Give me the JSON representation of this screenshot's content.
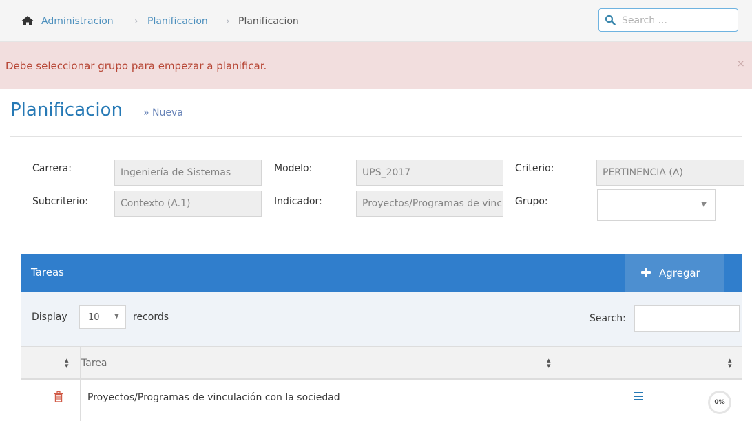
{
  "breadcrumbs": {
    "items": [
      "Administracion",
      "Planificacion",
      "Planificacion"
    ]
  },
  "search": {
    "placeholder": "Search ..."
  },
  "alert": {
    "message": "Debe seleccionar grupo para empezar a planificar.",
    "close_label": "×"
  },
  "page": {
    "title": "Planificacion",
    "subtitle": "» Nueva"
  },
  "form": {
    "carrera_label": "Carrera:",
    "carrera_value": "Ingeniería de Sistemas",
    "modelo_label": "Modelo:",
    "modelo_value": "UPS_2017",
    "criterio_label": "Criterio:",
    "criterio_value": "PERTINENCIA (A)",
    "subcriterio_label": "Subcriterio:",
    "subcriterio_value": "Contexto (A.1)",
    "indicador_label": "Indicador:",
    "indicador_value": "Proyectos/Programas de vinculación con la sociedad",
    "grupo_label": "Grupo:",
    "grupo_value": ""
  },
  "tasks_widget": {
    "title": "Tareas",
    "add_label": "Agregar",
    "display_label": "Display",
    "length_value": "10",
    "records_label": "records",
    "search_label": "Search:",
    "columns": [
      "",
      "Tarea",
      ""
    ],
    "rows": [
      {
        "tarea": "Proyectos/Programas de vinculación con la sociedad",
        "progress": "0%"
      }
    ]
  },
  "colors": {
    "accent": "#307ecc",
    "alert_bg": "#f2dede",
    "alert_text": "#b74635",
    "title": "#2679b5",
    "link": "#4c8fbd",
    "danger_icon": "#d15b47"
  },
  "icons": [
    "home-icon",
    "search-icon",
    "close-icon",
    "plus-icon",
    "trash-icon",
    "menu-icon",
    "sort-icon"
  ]
}
